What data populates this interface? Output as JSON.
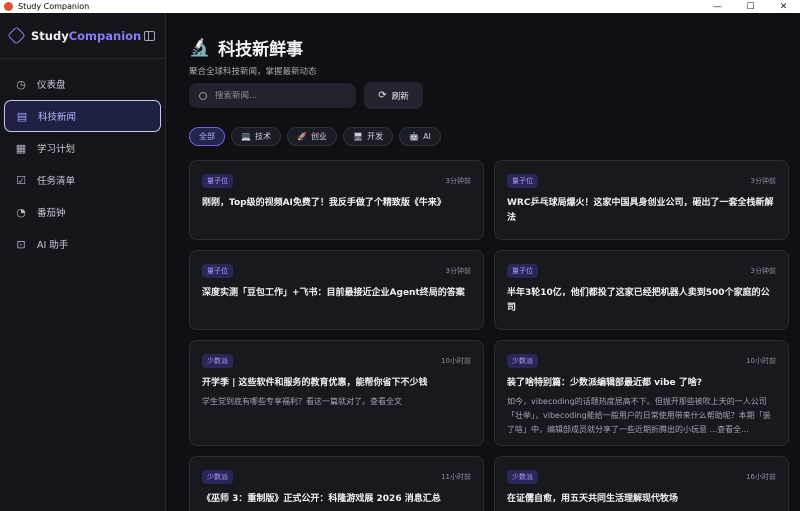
{
  "window": {
    "title": "Study Companion",
    "minimize": "—",
    "maximize": "☐",
    "close": "✕"
  },
  "brand": {
    "name_main": "Study",
    "name_accent": "Companion"
  },
  "sidebar": {
    "items": [
      {
        "label": "仪表盘",
        "icon": "◷"
      },
      {
        "label": "科技新闻",
        "icon": "▤"
      },
      {
        "label": "学习计划",
        "icon": "▦"
      },
      {
        "label": "任务清单",
        "icon": "☑"
      },
      {
        "label": "番茄钟",
        "icon": "◔"
      },
      {
        "label": "AI 助手",
        "icon": "⊡"
      }
    ]
  },
  "header": {
    "icon": "🔬",
    "title": "科技新鲜事",
    "subtitle": "聚合全球科技新闻，掌握最新动态"
  },
  "search": {
    "placeholder": "搜索新闻..."
  },
  "refresh": {
    "icon": "⟳",
    "label": "刷新"
  },
  "filters": [
    {
      "label": "全部",
      "icon": ""
    },
    {
      "label": "技术",
      "icon": "💻"
    },
    {
      "label": "创业",
      "icon": "🚀"
    },
    {
      "label": "开发",
      "icon": "🖥"
    },
    {
      "label": "AI",
      "icon": "🤖"
    }
  ],
  "colors": {
    "accent": "#8b7cf6",
    "background": "#0f0f14",
    "card": "#18181f"
  },
  "news": [
    {
      "source": "量子位",
      "time": "3分钟前",
      "headline": "刚刚，Top级的视频AI免费了！我反手做了个精致版《牛来》",
      "summary": ""
    },
    {
      "source": "量子位",
      "time": "3分钟前",
      "headline": "WRC乒乓球局爆火！这家中国具身创业公司，砸出了一套全栈新解法",
      "summary": ""
    },
    {
      "source": "量子位",
      "time": "3分钟前",
      "headline": "深度实测「豆包工作」+飞书：目前最接近企业Agent终局的答案",
      "summary": ""
    },
    {
      "source": "量子位",
      "time": "3分钟前",
      "headline": "半年3轮10亿，他们都投了这家已经把机器人卖到500个家庭的公司",
      "summary": ""
    },
    {
      "source": "少数派",
      "time": "10小时前",
      "headline": "开学季 | 这些软件和服务的教育优惠，能帮你省下不少钱",
      "summary": "学生党到底有哪些专享福利？看这一篇就对了。查看全文"
    },
    {
      "source": "少数派",
      "time": "10小时前",
      "headline": "装了啥特别篇：少数派编辑部最近都 vibe 了啥?",
      "summary": "如今，vibecoding的话题热度居高不下。但抛开那些被吹上天的一人公司「壮举」，vibecoding能给一般用户的日常使用带来什么帮助呢？本期「装了啥」中，编辑部成员就分享了一些近期折腾出的小玩意 ...查看全..."
    },
    {
      "source": "少数派",
      "time": "11小时前",
      "headline": "《巫师 3：重制版》正式公开：科隆游戏展 2026 消息汇总",
      "summary": ""
    },
    {
      "source": "少数派",
      "time": "16小时前",
      "headline": "在证儒自愈，用五天共同生活理解现代牧场",
      "summary": ""
    }
  ]
}
